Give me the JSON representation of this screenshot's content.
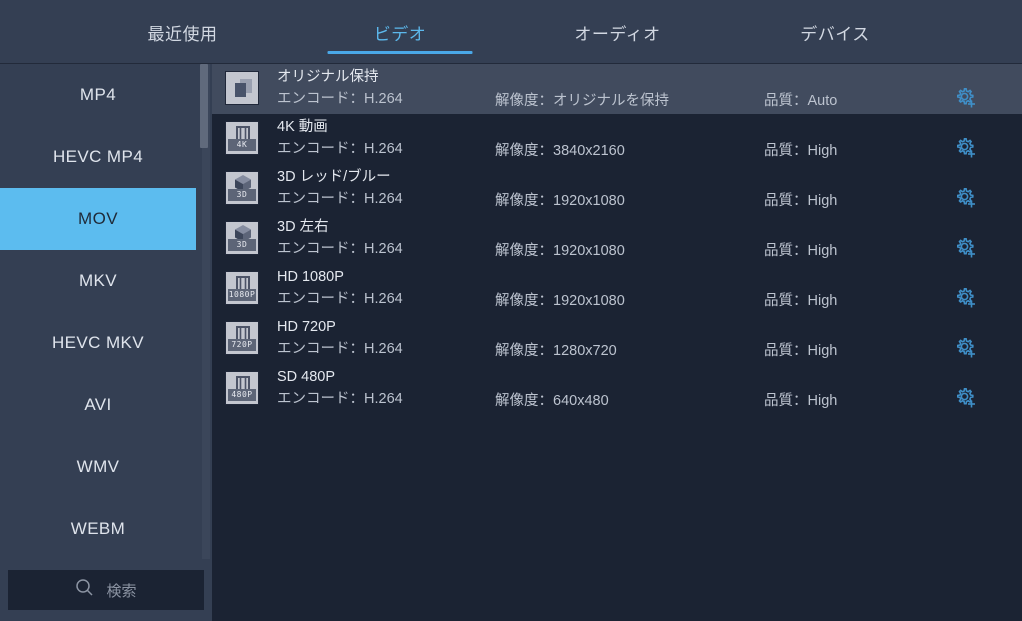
{
  "colors": {
    "accent": "#4aa8e8",
    "sidebar_selected": "#5cbcef",
    "panel_bg": "#343f53",
    "list_bg": "#1b2333",
    "row_selected": "#414b5e",
    "gear": "#3f8fc8"
  },
  "tabs": [
    {
      "label": "最近使用",
      "active": false
    },
    {
      "label": "ビデオ",
      "active": true
    },
    {
      "label": "オーディオ",
      "active": false
    },
    {
      "label": "デバイス",
      "active": false
    }
  ],
  "sidebar": {
    "items": [
      {
        "label": "MP4",
        "active": false
      },
      {
        "label": "HEVC MP4",
        "active": false
      },
      {
        "label": "MOV",
        "active": true
      },
      {
        "label": "MKV",
        "active": false
      },
      {
        "label": "HEVC MKV",
        "active": false
      },
      {
        "label": "AVI",
        "active": false
      },
      {
        "label": "WMV",
        "active": false
      },
      {
        "label": "WEBM",
        "active": false
      }
    ],
    "search": {
      "placeholder": "検索",
      "value": "",
      "icon": "search-icon"
    },
    "scrollbar": {
      "icon": "vertical-scrollbar"
    }
  },
  "list": {
    "gear_icon": "gear-plus-icon",
    "rows": [
      {
        "name": "オリジナル保持",
        "encode": "エンコード：H.264",
        "resolution": "解像度：オリジナルを保持",
        "quality": "品質：Auto",
        "icon": "keep-original-icon",
        "badge": "",
        "selected": true
      },
      {
        "name": "4K 動画",
        "encode": "エンコード：H.264",
        "resolution": "解像度：3840x2160",
        "quality": "品質：High",
        "icon": "film-4k-icon",
        "badge": "4K",
        "selected": false
      },
      {
        "name": "3D レッド/ブルー",
        "encode": "エンコード：H.264",
        "resolution": "解像度：1920x1080",
        "quality": "品質：High",
        "icon": "cube-3d-icon",
        "badge": "3D",
        "selected": false
      },
      {
        "name": "3D 左右",
        "encode": "エンコード：H.264",
        "resolution": "解像度：1920x1080",
        "quality": "品質：High",
        "icon": "cube-3d-icon",
        "badge": "3D",
        "selected": false
      },
      {
        "name": "HD 1080P",
        "encode": "エンコード：H.264",
        "resolution": "解像度：1920x1080",
        "quality": "品質：High",
        "icon": "film-1080p-icon",
        "badge": "1080P",
        "selected": false
      },
      {
        "name": "HD 720P",
        "encode": "エンコード：H.264",
        "resolution": "解像度：1280x720",
        "quality": "品質：High",
        "icon": "film-720p-icon",
        "badge": "720P",
        "selected": false
      },
      {
        "name": "SD 480P",
        "encode": "エンコード：H.264",
        "resolution": "解像度：640x480",
        "quality": "品質：High",
        "icon": "film-480p-icon",
        "badge": "480P",
        "selected": false
      }
    ]
  }
}
